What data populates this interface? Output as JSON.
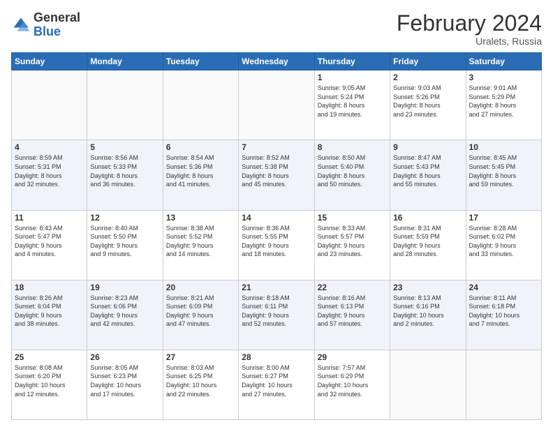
{
  "header": {
    "logo_general": "General",
    "logo_blue": "Blue",
    "month_title": "February 2024",
    "location": "Uralets, Russia"
  },
  "days_of_week": [
    "Sunday",
    "Monday",
    "Tuesday",
    "Wednesday",
    "Thursday",
    "Friday",
    "Saturday"
  ],
  "weeks": [
    [
      {
        "day": "",
        "info": ""
      },
      {
        "day": "",
        "info": ""
      },
      {
        "day": "",
        "info": ""
      },
      {
        "day": "",
        "info": ""
      },
      {
        "day": "1",
        "info": "Sunrise: 9:05 AM\nSunset: 5:24 PM\nDaylight: 8 hours\nand 19 minutes."
      },
      {
        "day": "2",
        "info": "Sunrise: 9:03 AM\nSunset: 5:26 PM\nDaylight: 8 hours\nand 23 minutes."
      },
      {
        "day": "3",
        "info": "Sunrise: 9:01 AM\nSunset: 5:29 PM\nDaylight: 8 hours\nand 27 minutes."
      }
    ],
    [
      {
        "day": "4",
        "info": "Sunrise: 8:59 AM\nSunset: 5:31 PM\nDaylight: 8 hours\nand 32 minutes."
      },
      {
        "day": "5",
        "info": "Sunrise: 8:56 AM\nSunset: 5:33 PM\nDaylight: 8 hours\nand 36 minutes."
      },
      {
        "day": "6",
        "info": "Sunrise: 8:54 AM\nSunset: 5:36 PM\nDaylight: 8 hours\nand 41 minutes."
      },
      {
        "day": "7",
        "info": "Sunrise: 8:52 AM\nSunset: 5:38 PM\nDaylight: 8 hours\nand 45 minutes."
      },
      {
        "day": "8",
        "info": "Sunrise: 8:50 AM\nSunset: 5:40 PM\nDaylight: 8 hours\nand 50 minutes."
      },
      {
        "day": "9",
        "info": "Sunrise: 8:47 AM\nSunset: 5:43 PM\nDaylight: 8 hours\nand 55 minutes."
      },
      {
        "day": "10",
        "info": "Sunrise: 8:45 AM\nSunset: 5:45 PM\nDaylight: 8 hours\nand 59 minutes."
      }
    ],
    [
      {
        "day": "11",
        "info": "Sunrise: 8:43 AM\nSunset: 5:47 PM\nDaylight: 9 hours\nand 4 minutes."
      },
      {
        "day": "12",
        "info": "Sunrise: 8:40 AM\nSunset: 5:50 PM\nDaylight: 9 hours\nand 9 minutes."
      },
      {
        "day": "13",
        "info": "Sunrise: 8:38 AM\nSunset: 5:52 PM\nDaylight: 9 hours\nand 14 minutes."
      },
      {
        "day": "14",
        "info": "Sunrise: 8:36 AM\nSunset: 5:55 PM\nDaylight: 9 hours\nand 18 minutes."
      },
      {
        "day": "15",
        "info": "Sunrise: 8:33 AM\nSunset: 5:57 PM\nDaylight: 9 hours\nand 23 minutes."
      },
      {
        "day": "16",
        "info": "Sunrise: 8:31 AM\nSunset: 5:59 PM\nDaylight: 9 hours\nand 28 minutes."
      },
      {
        "day": "17",
        "info": "Sunrise: 8:28 AM\nSunset: 6:02 PM\nDaylight: 9 hours\nand 33 minutes."
      }
    ],
    [
      {
        "day": "18",
        "info": "Sunrise: 8:26 AM\nSunset: 6:04 PM\nDaylight: 9 hours\nand 38 minutes."
      },
      {
        "day": "19",
        "info": "Sunrise: 8:23 AM\nSunset: 6:06 PM\nDaylight: 9 hours\nand 42 minutes."
      },
      {
        "day": "20",
        "info": "Sunrise: 8:21 AM\nSunset: 6:09 PM\nDaylight: 9 hours\nand 47 minutes."
      },
      {
        "day": "21",
        "info": "Sunrise: 8:18 AM\nSunset: 6:11 PM\nDaylight: 9 hours\nand 52 minutes."
      },
      {
        "day": "22",
        "info": "Sunrise: 8:16 AM\nSunset: 6:13 PM\nDaylight: 9 hours\nand 57 minutes."
      },
      {
        "day": "23",
        "info": "Sunrise: 8:13 AM\nSunset: 6:16 PM\nDaylight: 10 hours\nand 2 minutes."
      },
      {
        "day": "24",
        "info": "Sunrise: 8:11 AM\nSunset: 6:18 PM\nDaylight: 10 hours\nand 7 minutes."
      }
    ],
    [
      {
        "day": "25",
        "info": "Sunrise: 8:08 AM\nSunset: 6:20 PM\nDaylight: 10 hours\nand 12 minutes."
      },
      {
        "day": "26",
        "info": "Sunrise: 8:05 AM\nSunset: 6:23 PM\nDaylight: 10 hours\nand 17 minutes."
      },
      {
        "day": "27",
        "info": "Sunrise: 8:03 AM\nSunset: 6:25 PM\nDaylight: 10 hours\nand 22 minutes."
      },
      {
        "day": "28",
        "info": "Sunrise: 8:00 AM\nSunset: 6:27 PM\nDaylight: 10 hours\nand 27 minutes."
      },
      {
        "day": "29",
        "info": "Sunrise: 7:57 AM\nSunset: 6:29 PM\nDaylight: 10 hours\nand 32 minutes."
      },
      {
        "day": "",
        "info": ""
      },
      {
        "day": "",
        "info": ""
      }
    ]
  ]
}
